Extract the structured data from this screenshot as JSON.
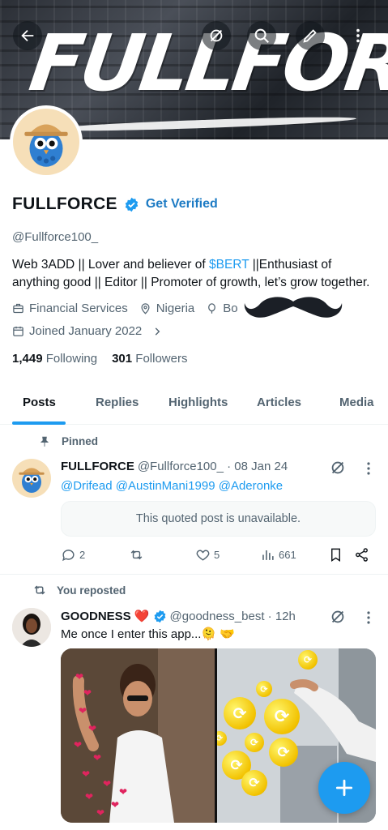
{
  "banner": {
    "brand_text": "FULLFORCE"
  },
  "topbar": {
    "back_icon": "arrow-left-icon",
    "grok_icon": "grok-icon",
    "search_icon": "search-icon",
    "edit_icon": "pencil-icon",
    "more_icon": "more-vertical-icon"
  },
  "profile": {
    "name": "FULLFORCE",
    "get_verified": "Get Verified",
    "handle": "@Fullforce100_",
    "bio_part1": "Web 3ADD || Lover and believer of ",
    "bio_tag": "$BERT",
    "bio_part2": " ||Enthusiast of anything good || Editor || Promoter of growth, let’s grow together.",
    "category": "Financial Services",
    "location": "Nigeria",
    "born_fragment": "Bo",
    "joined": "Joined January 2022",
    "following_count": "1,449",
    "following_label": "Following",
    "followers_count": "301",
    "followers_label": "Followers"
  },
  "tabs": [
    "Posts",
    "Replies",
    "Highlights",
    "Articles",
    "Media"
  ],
  "posts": [
    {
      "pinned_label": "Pinned",
      "name": "FULLFORCE",
      "handle_time": "@Fullforce100_ · 08 Jan 24",
      "mentions": "@Drifead @AustinMani1999 @Aderonke",
      "quote_text": "This quoted post is unavailable.",
      "replies": "2",
      "reposts": "",
      "likes": "5",
      "views": "661"
    },
    {
      "repost_label": "You reposted",
      "name": "GOODNESS ❤️",
      "handle_time": "@goodness_best · 12h",
      "text": "Me once I enter this app...🫠 🤝"
    }
  ],
  "colors": {
    "accent": "#1d9bf0",
    "verified": "#1d9bf0",
    "text": "#0f1419",
    "muted": "#536471"
  }
}
